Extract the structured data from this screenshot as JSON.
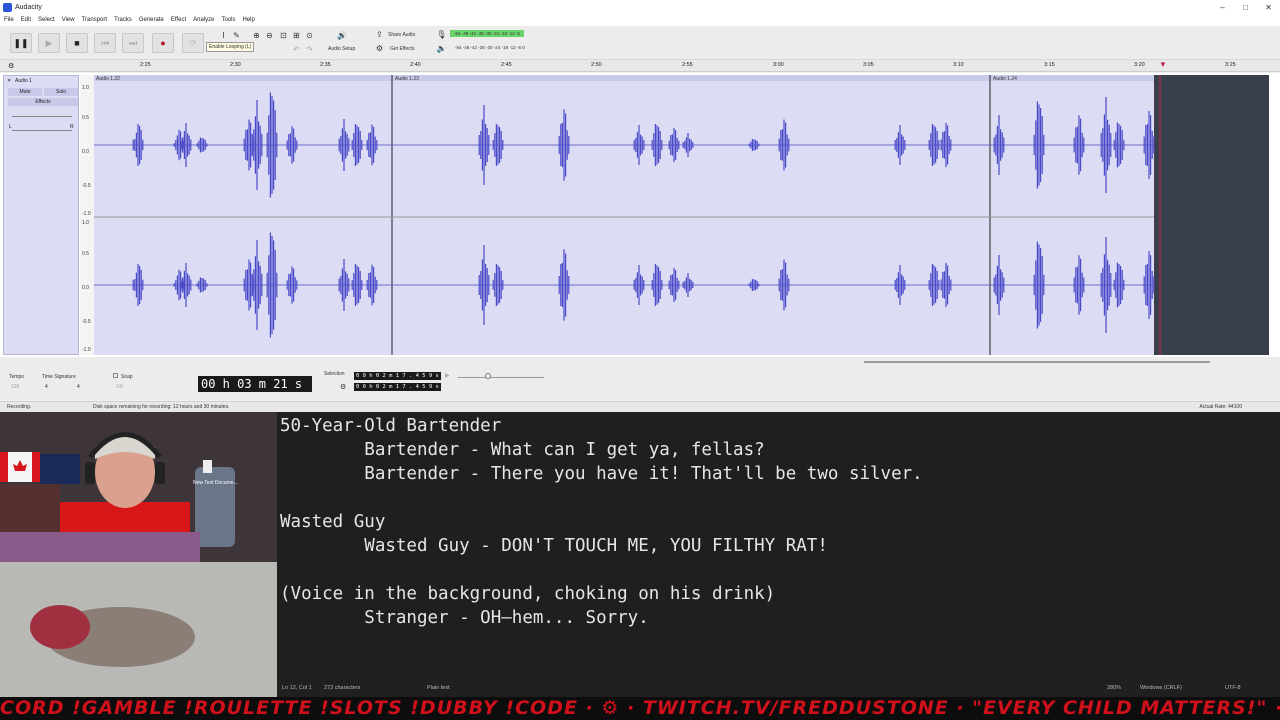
{
  "window": {
    "title": "Audacity",
    "controls": [
      "–",
      "□",
      "✕"
    ]
  },
  "menu": [
    "File",
    "Edit",
    "Select",
    "View",
    "Transport",
    "Tracks",
    "Generate",
    "Effect",
    "Analyze",
    "Tools",
    "Help"
  ],
  "toolbar": {
    "tooltip": "Enable Looping (L)",
    "audio_setup": "Audio Setup",
    "share_audio": "Share Audio",
    "get_effects": "Get Effects",
    "meter_rec": "-54  -48  -42  -36  -30  -24  -18  -12   -6",
    "meter_play": "-54  -48  -42  -36  -30  -24  -18  -12   -6   0"
  },
  "ruler": {
    "ticks": [
      "2:25",
      "2:30",
      "2:35",
      "2:40",
      "2:45",
      "2:50",
      "2:55",
      "3:00",
      "3:05",
      "3:10",
      "3:15",
      "3:20",
      "3:25"
    ]
  },
  "track": {
    "name": "Audio 1",
    "mute": "Mute",
    "solo": "Solo",
    "effects": "Effects",
    "pan_left": "L",
    "pan_right": "R",
    "clips": [
      "Audio 1.22",
      "Audio 1.23",
      "Audio 1.24"
    ],
    "scale_top": [
      "1.0",
      "0.5",
      "0.0",
      "-0.5",
      "-1.0"
    ],
    "scale_bottom": [
      "1.0",
      "0.5",
      "0.0",
      "-0.5",
      "-1.0"
    ]
  },
  "bottom": {
    "tempo_label": "Tempo",
    "tempo_value": "120",
    "timesig_label": "Time Signature",
    "timesig_num": "4",
    "timesig_den": "4",
    "snap_label": "Snap",
    "snap_value": "1/8",
    "time_display": "00 h 03 m 21 s",
    "selection_label": "Selection",
    "sel_start": "0 0 h 0 2 m 1 7 . 4 5 9 s",
    "sel_end": "0 0 h 0 2 m 1 7 . 4 5 9 s"
  },
  "status": {
    "left": "Recording.",
    "middle": "Disk space remaining for recording: 12 hours and 30 minutes.",
    "right": "Actual Rate: 44100"
  },
  "desktop_icon": {
    "label": "New Text Docume..."
  },
  "notepad": {
    "lines": [
      "50-Year-Old Bartender",
      "        Bartender - What can I get ya, fellas?",
      "        Bartender - There you have it! That'll be two silver.",
      "",
      "Wasted Guy",
      "        Wasted Guy - DON'T TOUCH ME, YOU FILTHY RAT!",
      "",
      "(Voice in the background, choking on his drink)",
      "        Stranger - OH—hem... Sorry."
    ],
    "status": {
      "pos": "Ln 12, Col 1",
      "chars": "273 characters",
      "format": "Plain text",
      "zoom": "280%",
      "eol": "Windows (CRLF)",
      "enc": "UTF-8"
    }
  },
  "ticker": "CORD !GAMBLE !ROULETTE !SLOTS !DUBBY !CODE · ⚙ · TWITCH.TV/FREDDUSTONE · \"EVERY CHILD MATTERS!\" · KICK.COM/FREDDUSTONE",
  "colors": {
    "wave": "#4a4ac8",
    "clip_bg": "#dcdcf4",
    "ticker": "#d0101a"
  }
}
